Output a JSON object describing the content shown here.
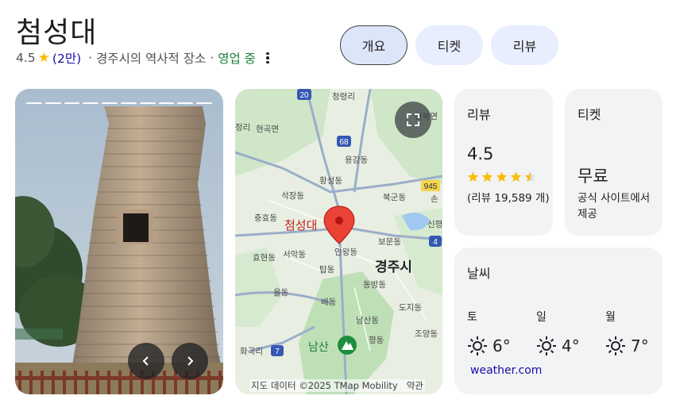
{
  "place": {
    "title": "첨성대",
    "rating": "4.5",
    "review_count": "(2만)",
    "category": "경주시의 역사적 장소",
    "status": "영업 중"
  },
  "tabs": [
    {
      "label": "개요",
      "active": true
    },
    {
      "label": "티켓",
      "active": false
    },
    {
      "label": "리뷰",
      "active": false
    }
  ],
  "map": {
    "attribution": "지도 데이터 ©2025 TMap Mobility",
    "terms": "약관",
    "pin_label": "첨성대",
    "city_label": "경주시",
    "mountain_label": "남산",
    "labels": [
      "청령리",
      "현곡면",
      "용강동",
      "황성동",
      "북군동",
      "석장동",
      "충효동",
      "서악동",
      "보문동",
      "효현동",
      "인왕동",
      "탑동",
      "동방동",
      "율동",
      "배동",
      "도지동",
      "남산동",
      "조양동",
      "평동",
      "화곡리",
      "손",
      "신평",
      "천북면",
      "정리"
    ],
    "routes": [
      "20",
      "68",
      "945",
      "7",
      "4"
    ]
  },
  "review_card": {
    "title": "리뷰",
    "score": "4.5",
    "rating_value": 4.5,
    "count_text": "(리뷰 19,589 개)"
  },
  "ticket_card": {
    "title": "티켓",
    "price": "무료",
    "source": "공식 사이트에서 제공"
  },
  "weather_card": {
    "title": "날씨",
    "days": [
      {
        "day": "토",
        "temp": "6°"
      },
      {
        "day": "일",
        "temp": "4°"
      },
      {
        "day": "월",
        "temp": "7°"
      }
    ],
    "link": "weather.com"
  },
  "colors": {
    "star": "#fbbc04",
    "link": "#1a0dab",
    "open": "#188038",
    "pin": "#ea4335",
    "tab_bg": "#e8eefe"
  }
}
